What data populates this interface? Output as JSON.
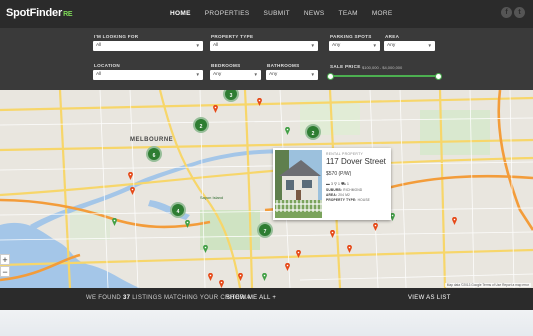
{
  "brand": {
    "name": "SpotFinder",
    "suffix": "RE"
  },
  "nav": {
    "items": [
      "HOME",
      "PROPERTIES",
      "SUBMIT",
      "NEWS",
      "TEAM",
      "MORE"
    ],
    "active": "HOME"
  },
  "social": {
    "facebook_glyph": "f",
    "twitter_glyph": "t"
  },
  "search": {
    "looking_for": {
      "label": "I'M LOOKING FOR",
      "value": "All"
    },
    "property_type": {
      "label": "PROPERTY TYPE",
      "value": "All"
    },
    "parking_spots": {
      "label": "PARKING SPOTS",
      "value": "Any"
    },
    "area": {
      "label": "AREA",
      "value": "Any"
    },
    "location": {
      "label": "LOCATION",
      "value": "All"
    },
    "bedrooms": {
      "label": "BEDROOMS",
      "value": "Any"
    },
    "bathrooms": {
      "label": "BATHROOMS",
      "value": "Any"
    },
    "sale_price": {
      "label": "SALE PRICE",
      "range": "$100,000 - $4,000,000",
      "min_fraction": 0.0,
      "max_fraction": 1.0
    }
  },
  "map": {
    "city_label": "MELBOURNE",
    "place_labels": [
      "Sayon Island"
    ],
    "clusters": [
      "3",
      "2",
      "2",
      "6",
      "4",
      "7"
    ],
    "zoom_in": "+",
    "zoom_out": "−",
    "attribution": "Map data ©2013 Google   Terms of Use   Report a map error"
  },
  "popup": {
    "type_label": "RENTAL PROPERTY",
    "title": "117 Dover Street",
    "price": "$570 (P/W)",
    "icons": "▬ 3   ⚲ 1   ⛟ 1",
    "suburb_label": "SUBURB:",
    "suburb": "RICHMOND",
    "area_label": "AREA:",
    "area": "204 M2",
    "property_type_label": "PROPERTY TYPE:",
    "property_type": "HOUSE"
  },
  "results": {
    "prefix": "WE FOUND",
    "count": "37",
    "suffix": "LISTINGS MATCHING YOUR CRITERIA",
    "show_all": "SHOW ME ALL +",
    "view_list": "VIEW AS LIST"
  },
  "colors": {
    "accent": "#4caf50",
    "header_bg": "#2b2b2b",
    "panel_bg": "#3a3a3a",
    "cluster": "#2e7d32",
    "pin_red": "#e64a19",
    "pin_green": "#43a047"
  }
}
